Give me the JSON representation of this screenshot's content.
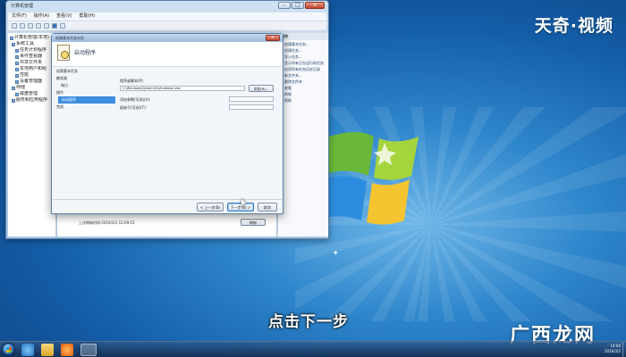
{
  "watermark": "天奇·视频",
  "subtitle": "点击下一步",
  "brand": "广西龙网",
  "brand_sub": "",
  "cm_window": {
    "title": "计算机管理",
    "menu": [
      "文件(F)",
      "操作(A)",
      "查看(V)",
      "帮助(H)"
    ],
    "tree": [
      "计算机管理(本地)",
      "系统工具",
      "任务计划程序",
      "事件查看器",
      "共享文件夹",
      "本地用户和组",
      "性能",
      "设备管理器",
      "存储",
      "磁盘管理",
      "服务和应用程序"
    ],
    "actions_header": "操作",
    "actions": [
      "创建基本任务...",
      "创建任务...",
      "导入任务...",
      "显示所有正在运行的任务",
      "启用所有任务历史记录",
      "新文件夹...",
      "删除文件夹",
      "查看",
      "刷新",
      "帮助"
    ],
    "footer_text": "上次刷新时间:2016/3/2 12:09:15",
    "footer_button": "刷新"
  },
  "wizard": {
    "title": "创建基本任务向导",
    "header": "启动程序",
    "steps": [
      "创建基本任务",
      "触发器",
      "每日",
      "操作",
      "启动程序",
      "完成"
    ],
    "program_label": "程序或脚本(P):",
    "program_value": "C:\\Windows\\System32\\shutdown.exe",
    "browse": "浏览(R)...",
    "args_label": "添加参数(可选)(A):",
    "start_label": "起始于(可选)(T):",
    "back": "< 上一步(B)",
    "next": "下一步(N) >",
    "cancel": "取消"
  },
  "taskbar": {
    "time": "14:00",
    "date": "2016/3/2"
  }
}
